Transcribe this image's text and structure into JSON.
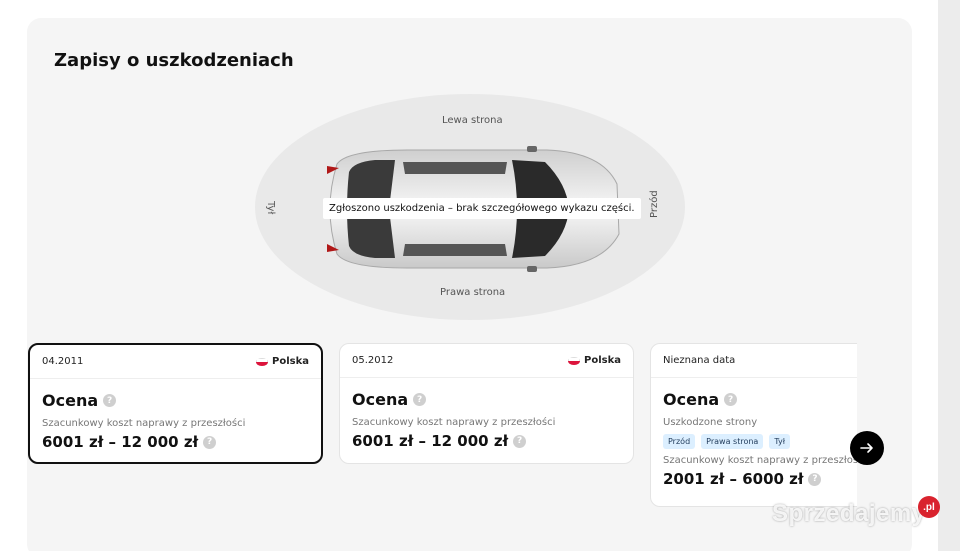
{
  "section": {
    "title": "Zapisy o uszkodzeniach"
  },
  "diagram": {
    "left_side": "Lewa strona",
    "right_side": "Prawa strona",
    "back": "Tył",
    "front": "Przód",
    "note": "Zgłoszono uszkodzenia – brak szczegółowego wykazu części."
  },
  "cards": [
    {
      "date": "04.2011",
      "country": "Polska",
      "rating_label": "Ocena",
      "cost_label": "Szacunkowy koszt naprawy z przeszłości",
      "cost_value": "6001 zł – 12 000 zł"
    },
    {
      "date": "05.2012",
      "country": "Polska",
      "rating_label": "Ocena",
      "cost_label": "Szacunkowy koszt naprawy z przeszłości",
      "cost_value": "6001 zł – 12 000 zł"
    },
    {
      "date": "Nieznana data",
      "rating_label": "Ocena",
      "damaged_label": "Uszkodzone strony",
      "tags": [
        "Przód",
        "Prawa strona",
        "Tył"
      ],
      "cost_label": "Szacunkowy koszt naprawy z przeszłości",
      "cost_value": "2001 zł – 6000 zł"
    }
  ],
  "icons": {
    "help": "?",
    "next": "arrow-right-icon"
  },
  "watermark": {
    "text": "Sprzedajemy",
    "badge": ".pl"
  },
  "colors": {
    "panel_bg": "#f5f5f5",
    "tag_bg": "#dcefff",
    "flag_red": "#dc143c"
  }
}
